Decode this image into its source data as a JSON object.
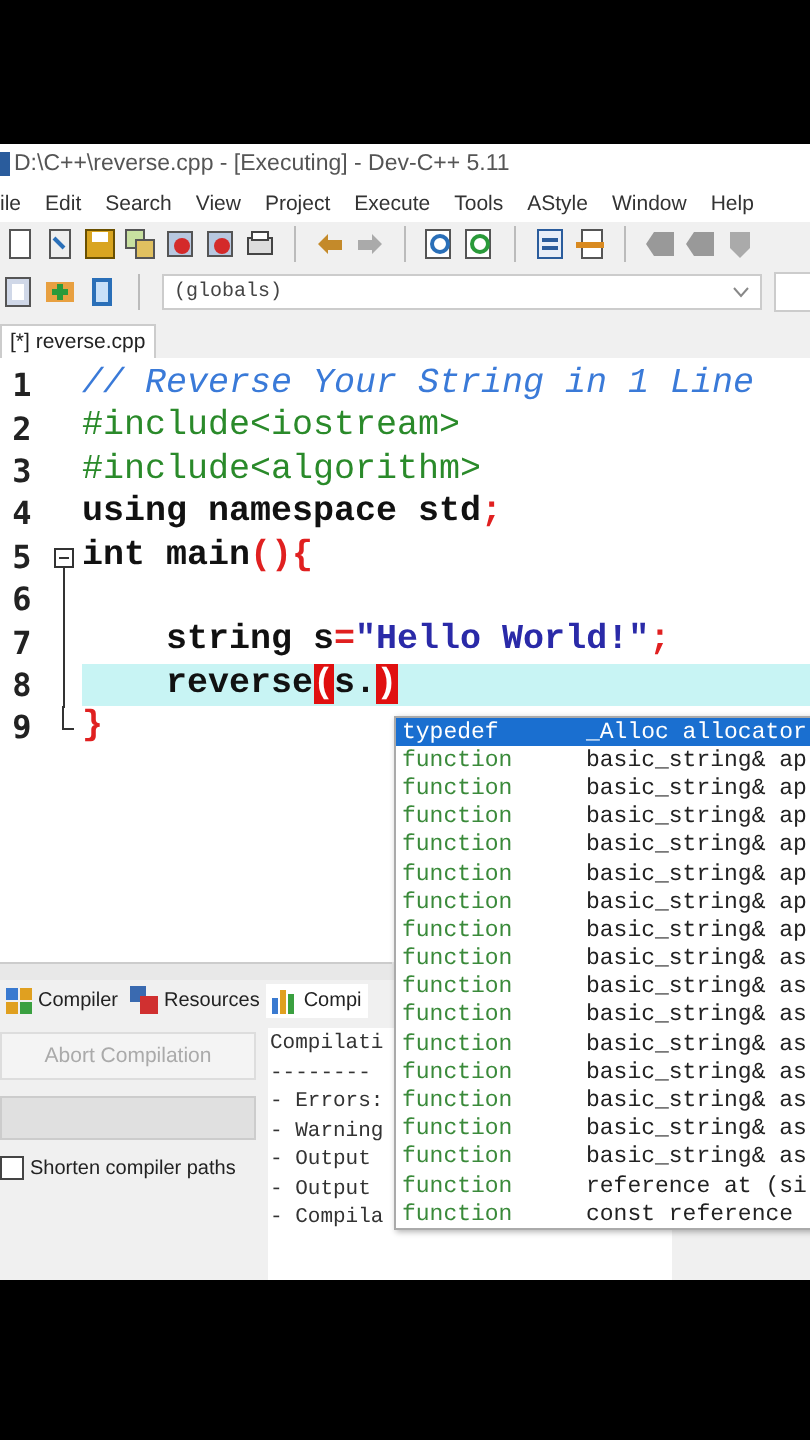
{
  "window": {
    "title": "D:\\C++\\reverse.cpp - [Executing] - Dev-C++ 5.11"
  },
  "menu": [
    "ile",
    "Edit",
    "Search",
    "View",
    "Project",
    "Execute",
    "Tools",
    "AStyle",
    "Window",
    "Help"
  ],
  "scope_combo": {
    "value": "(globals)"
  },
  "file_tabs": [
    {
      "label": "[*] reverse.cpp",
      "selected": true
    }
  ],
  "editor": {
    "lines": [
      {
        "number": "1",
        "kind": "plain",
        "current": false,
        "tokens": [
          {
            "kind": "comment",
            "text": "// Reverse Your String in 1 Line"
          }
        ]
      },
      {
        "number": "2",
        "kind": "plain",
        "current": false,
        "tokens": [
          {
            "kind": "preproc",
            "text": "#include<iostream>"
          }
        ]
      },
      {
        "number": "3",
        "kind": "plain",
        "current": false,
        "tokens": [
          {
            "kind": "preproc",
            "text": "#include<algorithm>"
          }
        ]
      },
      {
        "number": "4",
        "kind": "plain",
        "current": false,
        "tokens": [
          {
            "kind": "keyword",
            "text": "using namespace std"
          },
          {
            "kind": "punct",
            "text": ";"
          }
        ]
      },
      {
        "number": "5",
        "kind": "fold-start",
        "current": false,
        "tokens": [
          {
            "kind": "keyword",
            "text": "int main"
          },
          {
            "kind": "punct",
            "text": "(){"
          }
        ]
      },
      {
        "number": "6",
        "kind": "fold-body",
        "current": false
      },
      {
        "number": "7",
        "kind": "fold-body",
        "current": false,
        "tokens": [
          {
            "kind": "plain",
            "text": "    string s"
          },
          {
            "kind": "punct",
            "text": "="
          },
          {
            "kind": "string",
            "text": "\"Hello World!\""
          },
          {
            "kind": "punct",
            "text": ";"
          }
        ]
      },
      {
        "number": "8",
        "kind": "fold-body",
        "current": true,
        "tokens": [
          {
            "kind": "plain",
            "text": "    reverse"
          },
          {
            "kind": "match",
            "text": "("
          },
          {
            "kind": "plain",
            "text": "s."
          },
          {
            "kind": "match",
            "text": ")"
          }
        ]
      },
      {
        "number": "9",
        "kind": "fold-end",
        "current": false,
        "tokens": [
          {
            "kind": "punct",
            "text": "}"
          }
        ]
      }
    ]
  },
  "completion": [
    {
      "kind": "typedef",
      "signature": "_Alloc allocator",
      "selected": true
    },
    {
      "kind": "function",
      "signature": "basic_string& ap",
      "selected": false
    },
    {
      "kind": "function",
      "signature": "basic_string& ap",
      "selected": false
    },
    {
      "kind": "function",
      "signature": "basic_string& ap",
      "selected": false
    },
    {
      "kind": "function",
      "signature": "basic_string& ap",
      "selected": false
    },
    {
      "kind": "function",
      "signature": "basic_string& ap",
      "selected": false
    },
    {
      "kind": "function",
      "signature": "basic_string& ap",
      "selected": false
    },
    {
      "kind": "function",
      "signature": "basic_string& ap",
      "selected": false
    },
    {
      "kind": "function",
      "signature": "basic_string& as",
      "selected": false
    },
    {
      "kind": "function",
      "signature": "basic_string& as",
      "selected": false
    },
    {
      "kind": "function",
      "signature": "basic_string& as",
      "selected": false
    },
    {
      "kind": "function",
      "signature": "basic_string& as",
      "selected": false
    },
    {
      "kind": "function",
      "signature": "basic_string& as",
      "selected": false
    },
    {
      "kind": "function",
      "signature": "basic_string& as",
      "selected": false
    },
    {
      "kind": "function",
      "signature": "basic_string& as",
      "selected": false
    },
    {
      "kind": "function",
      "signature": "basic_string& as",
      "selected": false
    },
    {
      "kind": "function",
      "signature": "reference at (si",
      "selected": false
    },
    {
      "kind": "function",
      "signature": "const reference",
      "selected": false
    }
  ],
  "bottom_panel": {
    "tabs": [
      {
        "label": "Compiler",
        "selected": false
      },
      {
        "label": "Resources",
        "selected": false
      },
      {
        "label": "Compi",
        "selected": true
      }
    ],
    "abort_button": {
      "label": "Abort Compilation",
      "disabled": true
    },
    "shorten_paths": {
      "label": "Shorten compiler paths",
      "checked": false
    },
    "log": [
      "Compilati",
      "--------",
      "- Errors:",
      "- Warning",
      "- Output",
      "- Output",
      "- Compila"
    ]
  }
}
